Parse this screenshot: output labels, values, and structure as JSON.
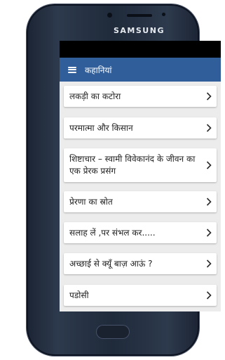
{
  "device": {
    "brand": "SAMSUNG"
  },
  "appbar": {
    "title": "कहानियां"
  },
  "items": [
    {
      "label": "लकड़ी का कटोरा"
    },
    {
      "label": "परमात्मा और किसान"
    },
    {
      "label": "शिष्टाचार – स्वामी विवेकानंद के जीवन का एक प्रेरक प्रसंग"
    },
    {
      "label": "प्रेरणा का स्रोत"
    },
    {
      "label": "सलाह लें ,पर संभल कर....."
    },
    {
      "label": "अच्छाई से क्यूँ बाज़ आऊं ?"
    },
    {
      "label": "पडोसी"
    }
  ],
  "colors": {
    "appbar": "#2f5e9a",
    "screen_bg": "#ececec",
    "chevron": "#2a2a2a"
  },
  "icons": {
    "menu": "hamburger-menu-icon",
    "chevron": "chevron-right-icon"
  }
}
